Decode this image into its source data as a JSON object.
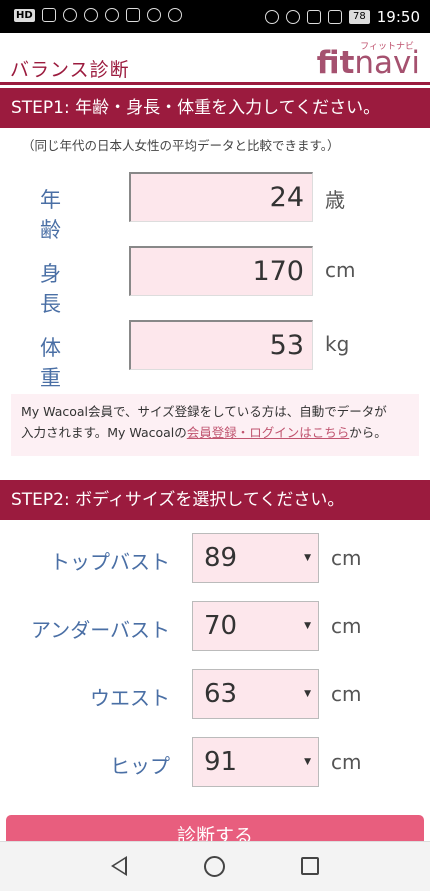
{
  "status_bar": {
    "left_tag": "HD",
    "battery": "78",
    "time": "19:50"
  },
  "header": {
    "title": "バランス診断",
    "logo_sub": "フィットナビ",
    "logo_fit": "fit",
    "logo_navi": "navi"
  },
  "step1": {
    "heading": "STEP1: 年齢・身長・体重を入力してください。",
    "note": "（同じ年代の日本人女性の平均データと比較できます。）",
    "age": {
      "label": "年齢",
      "value": "24",
      "unit": "歳"
    },
    "height": {
      "label": "身長",
      "value": "170",
      "unit": "cm"
    },
    "weight": {
      "label": "体重",
      "value": "53",
      "unit": "kg"
    }
  },
  "info": {
    "line1": "My Wacoal会員で、サイズ登録をしている方は、自動でデータが",
    "line2_prefix": "入力されます。My Wacoalの",
    "link": "会員登録・ログインはこちら",
    "line2_suffix": "から。"
  },
  "step2": {
    "heading": "STEP2: ボディサイズを選択してください。",
    "rows": [
      {
        "label": "トップバスト",
        "value": "89",
        "unit": "cm"
      },
      {
        "label": "アンダーバスト",
        "value": "70",
        "unit": "cm"
      },
      {
        "label": "ウエスト",
        "value": "63",
        "unit": "cm"
      },
      {
        "label": "ヒップ",
        "value": "91",
        "unit": "cm"
      }
    ]
  },
  "diagnose_button": "診断する",
  "colors": {
    "brand": "#9b1b3e",
    "field_bg": "#fde7ec",
    "label_blue": "#4a6fa5",
    "button": "#e85e7e"
  }
}
